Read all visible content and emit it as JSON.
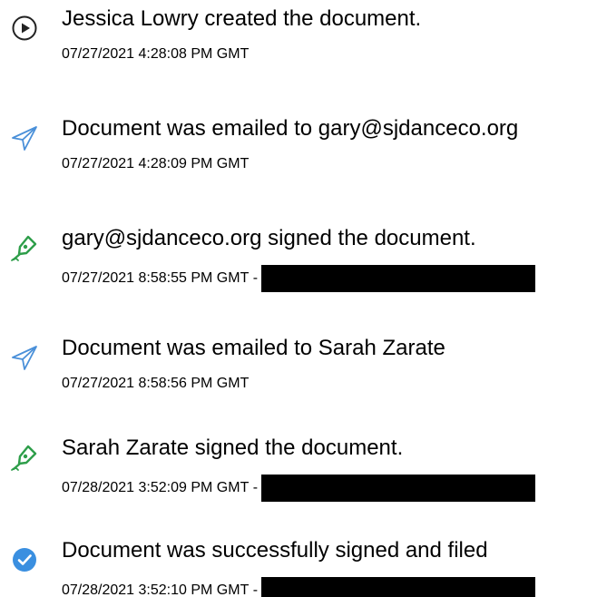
{
  "colors": {
    "send_icon": "#4a90d9",
    "pen_icon": "#2e9e4a",
    "check_icon": "#3a8fe0",
    "redaction": "#000000"
  },
  "events": [
    {
      "icon": "play-circle-icon",
      "title": "Jessica Lowry created the document.",
      "timestamp": "07/27/2021 4:28:08 PM GMT",
      "redacted_suffix": ""
    },
    {
      "icon": "send-icon",
      "title": "Document was emailed to gary@sjdanceco.org",
      "timestamp": "07/27/2021 4:28:09 PM GMT",
      "redacted_suffix": ""
    },
    {
      "icon": "pen-icon",
      "title": "gary@sjdanceco.org signed the document.",
      "timestamp": "07/27/2021 8:58:55 PM GMT",
      "redacted_suffix": "-"
    },
    {
      "icon": "send-icon",
      "title": "Document was emailed to Sarah Zarate",
      "timestamp": "07/27/2021 8:58:56 PM GMT",
      "redacted_suffix": ""
    },
    {
      "icon": "pen-icon",
      "title": "Sarah Zarate signed the document.",
      "timestamp": "07/28/2021 3:52:09 PM GMT",
      "redacted_suffix": "-"
    },
    {
      "icon": "check-circle-icon",
      "title": "Document was successfully signed and filed",
      "timestamp": "07/28/2021 3:52:10 PM GMT",
      "redacted_suffix": "-"
    }
  ]
}
